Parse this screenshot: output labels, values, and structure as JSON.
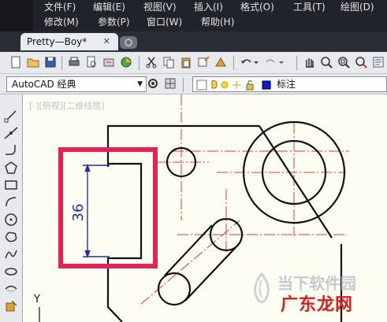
{
  "menu": {
    "row1": [
      "文件(F)",
      "编辑(E)",
      "视图(V)",
      "插入(I)",
      "格式(O)",
      "工具(T)",
      "绘图(D)"
    ],
    "row2": [
      "修改(M)",
      "参数(P)",
      "窗口(W)",
      "帮助(H)"
    ]
  },
  "tabs": {
    "active": "Pretty—Boy*",
    "close": "✕"
  },
  "workspace": {
    "value": "AutoCAD 经典",
    "arrow": "▼"
  },
  "layer": {
    "current": "标注"
  },
  "canvas": {
    "view_label": "[-][俯视][二维线框]",
    "dimension_text": "36",
    "ucs_label": "Y"
  },
  "watermark": {
    "line1": "当下软件园",
    "line2": "广东龙网"
  },
  "colors": {
    "highlight": "#e8205a",
    "centerline": "#e23a3a",
    "dimension": "#2a2aa8",
    "outline": "#111111"
  }
}
